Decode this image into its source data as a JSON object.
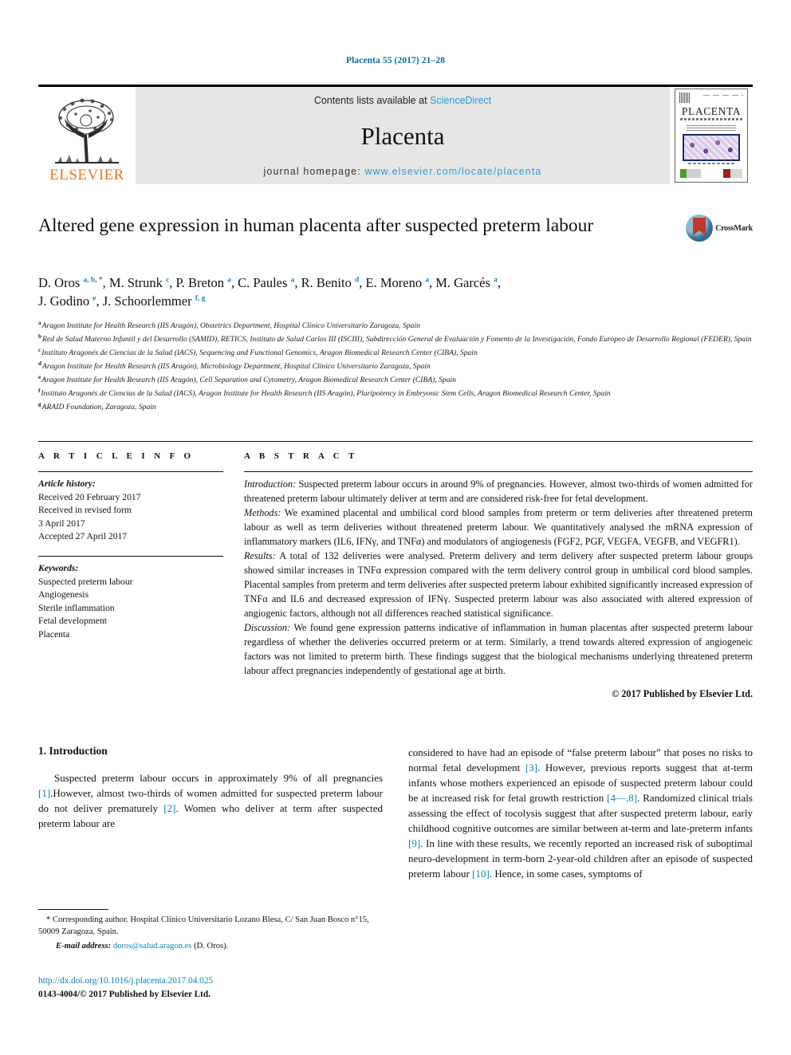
{
  "running_head": "Placenta 55 (2017) 21–28",
  "masthead": {
    "publisher_name": "ELSEVIER",
    "contents_prefix": "Contents lists available at ",
    "contents_link": "ScienceDirect",
    "journal_name": "Placenta",
    "homepage_prefix": "journal homepage: ",
    "homepage_url": "www.elsevier.com/locate/placenta",
    "cover_title": "PLACENTA"
  },
  "crossmark": {
    "label": "CrossMark"
  },
  "article": {
    "title": "Altered gene expression in human placenta after suspected preterm labour",
    "authors_line1_html": "D. Oros <sup>a, b, *</sup>, M. Strunk <sup>c</sup>, P. Breton <sup>a</sup>, C. Paules <sup>a</sup>, R. Benito <sup>d</sup>, E. Moreno <sup>a</sup>, M. Garcés <sup>a</sup>,",
    "authors_line2_html": "J. Godino <sup>e</sup>, J. Schoorlemmer <sup>f, g</sup>",
    "affiliations": [
      {
        "mark": "a",
        "text": "Aragon Institute for Health Research (IIS Aragón), Obstetrics Department, Hospital Clínico Universitario Zaragoza, Spain"
      },
      {
        "mark": "b",
        "text": "Red de Salud Materno Infantil y del Desarrollo (SAMID), RETICS, Instituto de Salud Carlos III (ISCIII), Subdirección General de Evaluación y Fomento de la Investigación, Fondo Europeo de Desarrollo Regional (FEDER), Spain"
      },
      {
        "mark": "c",
        "text": "Instituto Aragonés de Ciencias de la Salud (IACS), Sequencing and Functional Genomics, Aragon Biomedical Research Center (CIBA), Spain"
      },
      {
        "mark": "d",
        "text": "Aragon Institute for Health Research (IIS Aragón), Microbiology Department, Hospital Clínico Universitario Zaragoza, Spain"
      },
      {
        "mark": "e",
        "text": "Aragon Institute for Health Research (IIS Aragón), Cell Separation and Cytometry, Aragon Biomedical Research Center (CIBA), Spain"
      },
      {
        "mark": "f",
        "text": "Instituto Aragonés de Ciencias de la Salud (IACS), Aragon Institute for Health Research (IIS Aragón), Pluripotency in Embryonic Stem Cells, Aragon Biomedical Research Center, Spain"
      },
      {
        "mark": "g",
        "text": "ARAID Foundation, Zaragoza, Spain"
      }
    ]
  },
  "article_info": {
    "heading": "A R T I C L E   I N F O",
    "history_label": "Article history:",
    "history": [
      "Received 20 February 2017",
      "Received in revised form",
      "3 April 2017",
      "Accepted 27 April 2017"
    ],
    "keywords_label": "Keywords:",
    "keywords": [
      "Suspected preterm labour",
      "Angiogenesis",
      "Sterile inflammation",
      "Fetal development",
      "Placenta"
    ]
  },
  "abstract": {
    "heading": "A B S T R A C T",
    "sections": [
      {
        "label": "Introduction:",
        "text": " Suspected preterm labour occurs in around 9% of pregnancies. However, almost two-thirds of women admitted for threatened preterm labour ultimately deliver at term and are considered risk-free for fetal development."
      },
      {
        "label": "Methods:",
        "text": " We examined placental and umbilical cord blood samples from preterm or term deliveries after threatened preterm labour as well as term deliveries without threatened preterm labour. We quantitatively analysed the mRNA expression of inflammatory markers (IL6, IFNγ, and TNFα) and modulators of angiogenesis (FGF2, PGF, VEGFA, VEGFB, and VEGFR1)."
      },
      {
        "label": "Results:",
        "text": " A total of 132 deliveries were analysed. Preterm delivery and term delivery after suspected preterm labour groups showed similar increases in TNFα expression compared with the term delivery control group in umbilical cord blood samples. Placental samples from preterm and term deliveries after suspected preterm labour exhibited significantly increased expression of TNFα and IL6 and decreased expression of IFNγ. Suspected preterm labour was also associated with altered expression of angiogenic factors, although not all differences reached statistical significance."
      },
      {
        "label": "Discussion:",
        "text": " We found gene expression patterns indicative of inflammation in human placentas after suspected preterm labour regardless of whether the deliveries occurred preterm or at term. Similarly, a trend towards altered expression of angiogeneic factors was not limited to preterm birth. These findings suggest that the biological mechanisms underlying threatened preterm labour affect pregnancies independently of gestational age at birth."
      }
    ],
    "copyright": "© 2017 Published by Elsevier Ltd."
  },
  "introduction": {
    "heading": "1.  Introduction",
    "left_paragraph_html": "Suspected preterm labour occurs in approximately 9% of all pregnancies <span class=\"ref\">[1]</span>.However, almost two-thirds of women admitted for suspected preterm labour do not deliver prematurely <span class=\"ref\">[2]</span>. Women who deliver at term after suspected preterm labour are",
    "right_paragraph_html": "considered to have had an episode of &ldquo;false preterm labour&rdquo; that poses no risks to normal fetal development <span class=\"ref\">[3]</span>. However, previous reports suggest that at-term infants whose mothers experienced an episode of suspected preterm labour could be at increased risk for fetal growth restriction <span class=\"ref\">[4&mdash;,8]</span>. Randomized clinical trials assessing the effect of tocolysis suggest that after suspected preterm labour, early childhood cognitive outcomes are similar between at-term and late-preterm infants <span class=\"ref\">[9]</span>. In line with these results, we recently reported an increased risk of suboptimal neuro-development in term-born 2-year-old children after an episode of suspected preterm labour <span class=\"ref\">[10]</span>. Hence, in some cases, symptoms of"
  },
  "footnote": {
    "corresponding_html": "* Corresponding author. Hospital Clínico Universitario Lozano Blesa, C/ San Juan Bosco n&deg;15, 50009 Zaragoza, Spain.",
    "email_label": "E-mail address:",
    "email": "doros@salud.aragon.es",
    "email_owner": "(D. Oros)."
  },
  "imprint": {
    "doi": "http://dx.doi.org/10.1016/j.placenta.2017.04.025",
    "issn_line": "0143-4004/© 2017 Published by Elsevier Ltd."
  },
  "colors": {
    "link": "#0d7fb5",
    "sciencedirect": "#2b9bd4",
    "elsevier_orange": "#e87722",
    "masthead_bg": "#e6e6e6"
  }
}
